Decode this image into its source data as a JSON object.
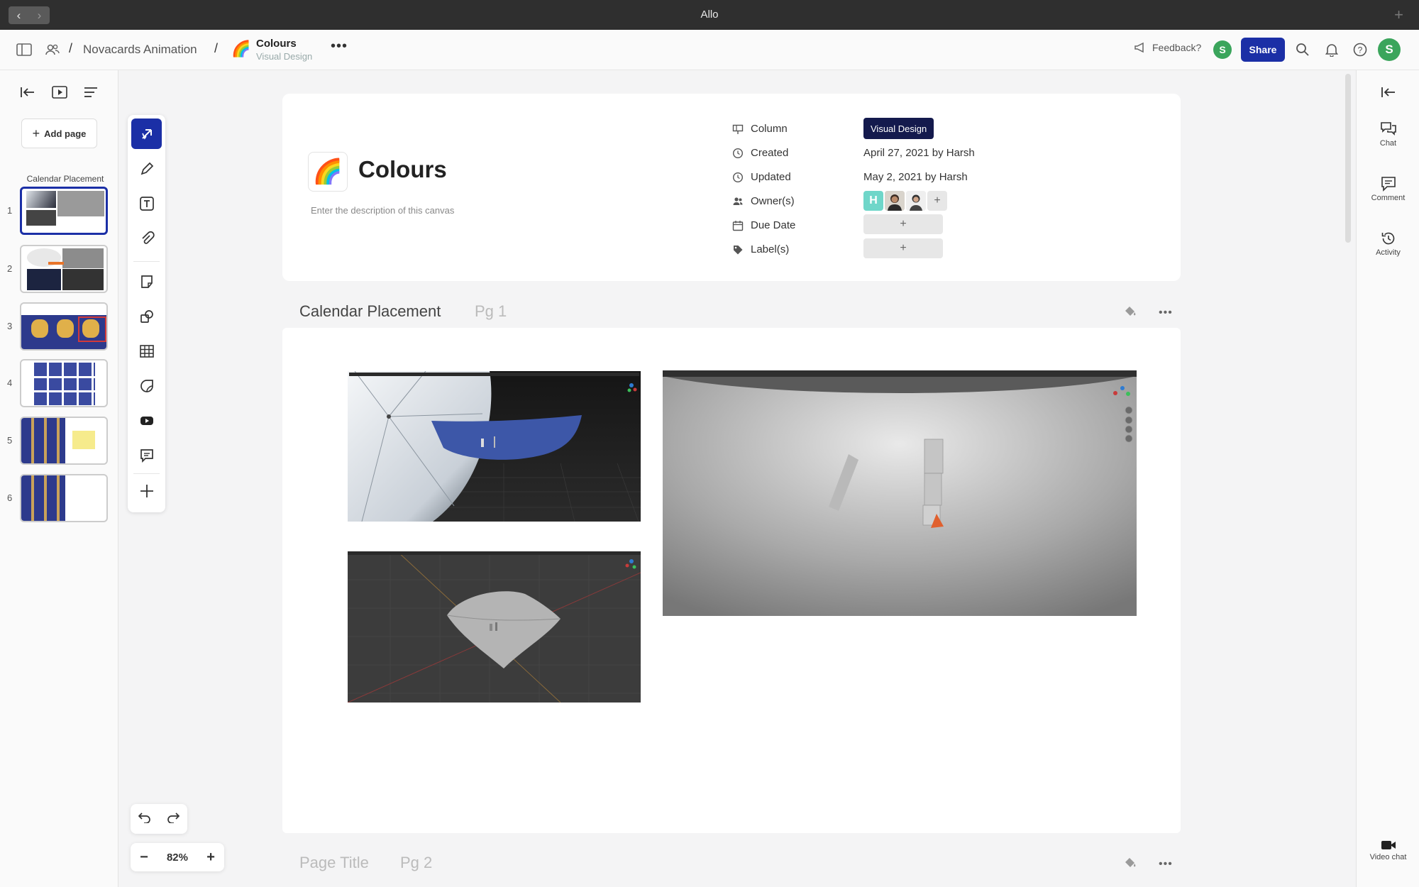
{
  "app": {
    "title": "Allo"
  },
  "header": {
    "breadcrumb": [
      "Novacards Animation",
      "/"
    ],
    "canvas_emoji": "🌈",
    "canvas_title": "Colours",
    "canvas_subtitle": "Visual Design",
    "feedback_label": "Feedback?",
    "share_label": "Share",
    "user_initial": "S"
  },
  "left_panel": {
    "add_page_label": "Add page",
    "group_label": "Calendar Placement",
    "pages": [
      {
        "num": "1"
      },
      {
        "num": "2"
      },
      {
        "num": "3"
      },
      {
        "num": "4"
      },
      {
        "num": "5"
      },
      {
        "num": "6"
      }
    ]
  },
  "info": {
    "emoji": "🌈",
    "title": "Colours",
    "description_placeholder": "Enter the description of this canvas",
    "props": {
      "column_label": "Column",
      "column_value": "Visual Design",
      "created_label": "Created",
      "created_value": "April 27, 2021 by Harsh",
      "updated_label": "Updated",
      "updated_value": "May 2, 2021 by Harsh",
      "owners_label": "Owner(s)",
      "owner_initial": "H",
      "due_label": "Due Date",
      "labels_label": "Label(s)",
      "add_symbol": "+"
    }
  },
  "page1": {
    "title": "Calendar Placement",
    "num": "Pg 1"
  },
  "page2": {
    "title": "Page Title",
    "num": "Pg 2"
  },
  "zoom": {
    "value": "82%"
  },
  "right_panel": {
    "chat": "Chat",
    "comment": "Comment",
    "activity": "Activity",
    "video_chat": "Video chat"
  },
  "colors": {
    "accent": "#1b2fa6",
    "pill": "#141a4d",
    "avatar": "#3ba55c",
    "owner_h": "#6fd6c9"
  }
}
